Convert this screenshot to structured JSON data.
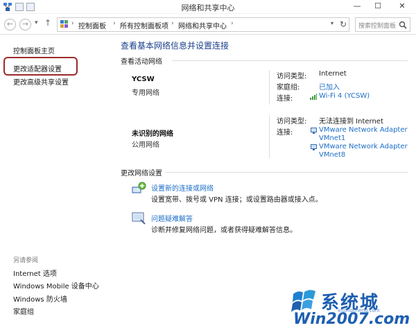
{
  "window": {
    "title": "网络和共享中心",
    "minimize": "—",
    "maximize": "☐",
    "close": "✕"
  },
  "nav": {
    "back": "←",
    "forward": "→",
    "up": "↑",
    "breadcrumbs": [
      "控制面板",
      "所有控制面板项",
      "网络和共享中心"
    ],
    "search_placeholder": "搜索控制面板"
  },
  "sidebar": {
    "home": "控制面板主页",
    "items": [
      {
        "label": "更改适配器设置"
      },
      {
        "label": "更改高级共享设置"
      }
    ],
    "see_also_title": "另请参阅",
    "see_also": [
      {
        "label": "Internet 选项"
      },
      {
        "label": "Windows Mobile 设备中心"
      },
      {
        "label": "Windows 防火墙"
      },
      {
        "label": "家庭组"
      }
    ]
  },
  "main": {
    "title": "查看基本网络信息并设置连接",
    "active_heading": "查看活动网络",
    "networks": [
      {
        "name": "YCSW",
        "category": "专用网络",
        "access_label": "访问类型:",
        "access_value": "Internet",
        "homegroup_label": "家庭组:",
        "homegroup_value": "已加入",
        "conn_label": "连接:",
        "conn_value": "Wi-Fi 4 (YCSW)"
      },
      {
        "name": "未识别的网络",
        "category": "公用网络",
        "access_label": "访问类型:",
        "access_value": "无法连接到 Internet",
        "conn_label": "连接:",
        "conn_value_1": "VMware Network Adapter",
        "conn_value_1b": "VMnet1",
        "conn_value_2": "VMware Network Adapter",
        "conn_value_2b": "VMnet8"
      }
    ],
    "change_heading": "更改网络设置",
    "tasks": [
      {
        "link": "设置新的连接或网络",
        "desc": "设置宽带、拨号或 VPN 连接；或设置路由器或接入点。"
      },
      {
        "link": "问题疑难解答",
        "desc": "诊断并修复网络问题，或者获得疑难解答信息。"
      }
    ]
  },
  "watermark": {
    "cn": "系统城",
    "en": "Win2007.com",
    "sub": "xitongcheng.com"
  },
  "colors": {
    "link": "#1d6ec7",
    "title": "#1b3f8b",
    "highlight": "#9b2b2b"
  }
}
